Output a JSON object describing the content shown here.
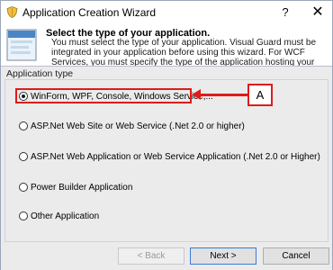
{
  "window": {
    "title": "Application Creation Wizard",
    "help_label": "?",
    "close_label": "✕"
  },
  "header": {
    "title": "Select the type of your application.",
    "description": "You must select the type of your application. Visual Guard must be integrated in your application before using this wizard. For WCF Services, you must specify the type of the application hosting your services"
  },
  "group": {
    "label": "Application type",
    "options": [
      {
        "label": "WinForm, WPF, Console, Windows Service,...",
        "selected": true
      },
      {
        "label": "ASP.Net Web Site or Web Service (.Net 2.0 or higher)",
        "selected": false
      },
      {
        "label": "ASP.Net Web Application or Web Service Application (.Net 2.0 or Higher)",
        "selected": false
      },
      {
        "label": "Power Builder Application",
        "selected": false
      },
      {
        "label": "Other Application",
        "selected": false
      }
    ]
  },
  "annotation": {
    "callout_label": "A",
    "color": "#dd1c1c"
  },
  "buttons": {
    "back": "< Back",
    "next": "Next >",
    "cancel": "Cancel"
  }
}
